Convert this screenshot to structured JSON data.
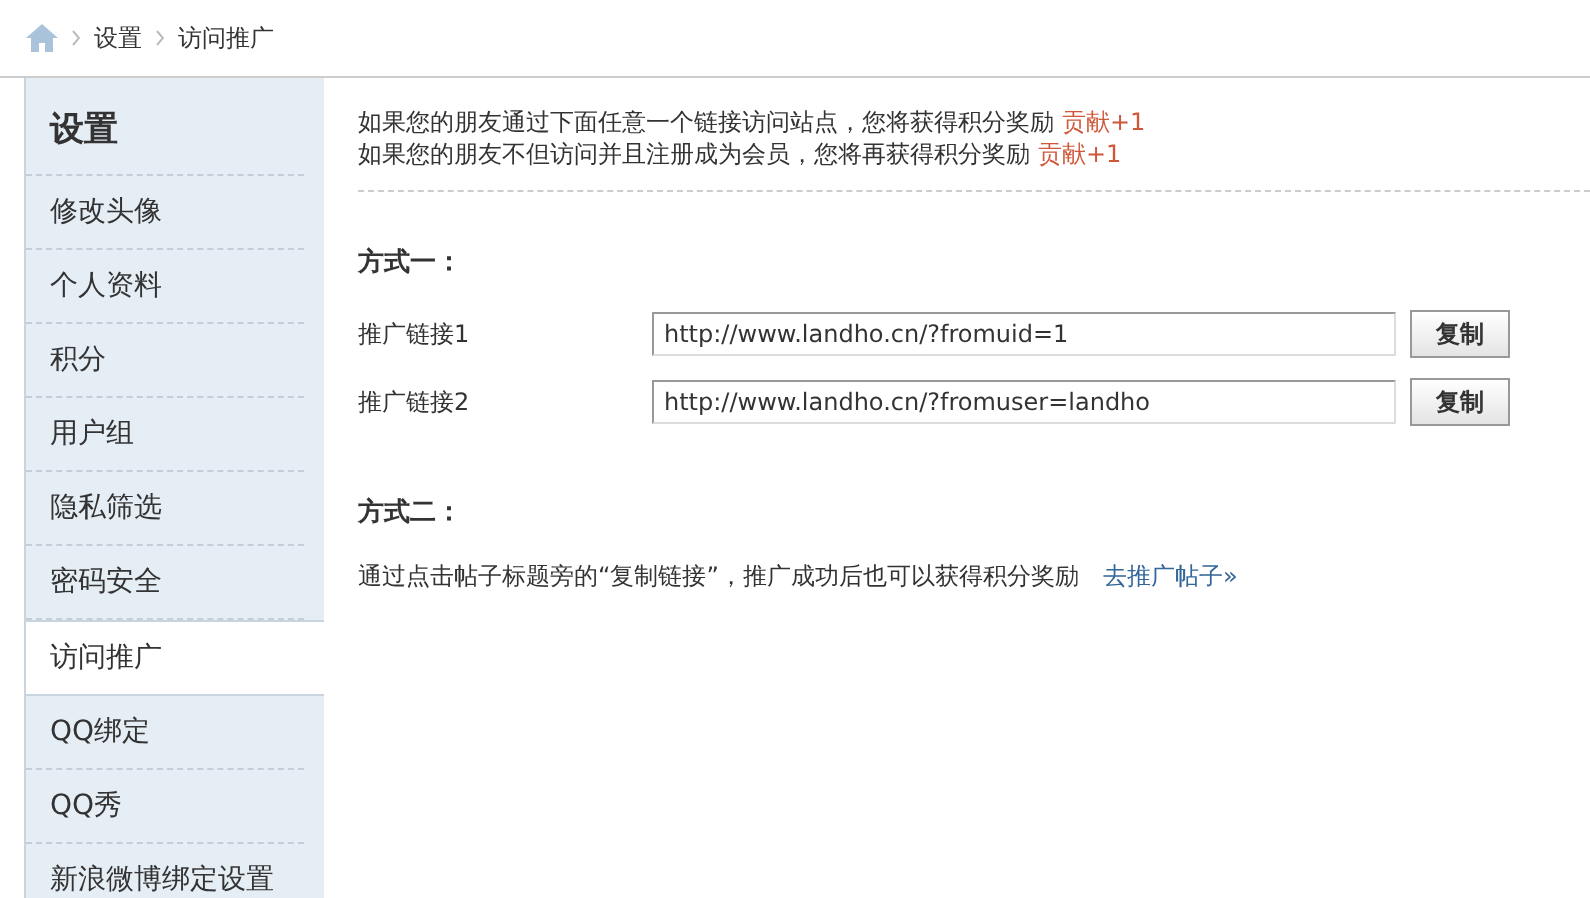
{
  "breadcrumb": [
    "设置",
    "访问推广"
  ],
  "sidebar": {
    "title": "设置",
    "items": [
      {
        "label": "修改头像",
        "selected": false
      },
      {
        "label": "个人资料",
        "selected": false
      },
      {
        "label": "积分",
        "selected": false
      },
      {
        "label": "用户组",
        "selected": false
      },
      {
        "label": "隐私筛选",
        "selected": false
      },
      {
        "label": "密码安全",
        "selected": false
      },
      {
        "label": "访问推广",
        "selected": true
      },
      {
        "label": "QQ绑定",
        "selected": false
      },
      {
        "label": "QQ秀",
        "selected": false
      },
      {
        "label": "新浪微博绑定设置",
        "selected": false
      }
    ]
  },
  "intro": [
    {
      "text": "如果您的朋友通过下面任意一个链接访问站点，您将获得积分奖励",
      "reward": "贡献+1"
    },
    {
      "text": "如果您的朋友不但访问并且注册成为会员，您将再获得积分奖励",
      "reward": "贡献+1"
    }
  ],
  "method1": {
    "heading": "方式一：",
    "links": [
      {
        "label": "推广链接1",
        "value": "http://www.landho.cn/?fromuid=1",
        "button": "复制"
      },
      {
        "label": "推广链接2",
        "value": "http://www.landho.cn/?fromuser=landho",
        "button": "复制"
      }
    ]
  },
  "method2": {
    "heading": "方式二：",
    "text": "通过点击帖子标题旁的“复制链接”，推广成功后也可以获得积分奖励",
    "link": "去推广帖子»"
  }
}
